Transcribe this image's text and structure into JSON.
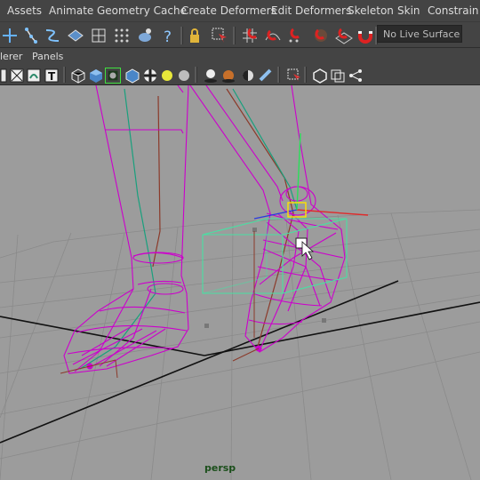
{
  "menubar": {
    "items": [
      "Assets",
      "Animate",
      "Geometry Cache",
      "Create Deformers",
      "Edit Deformers",
      "Skeleton",
      "Skin",
      "Constrain"
    ]
  },
  "shelf": {
    "live_surface": "No Live Surface",
    "icons": [
      "insert-joint-icon",
      "ik-handle-icon",
      "ik-spline-icon",
      "bind-skin-icon",
      "lattice-icon",
      "paint-weights-icon",
      "cluster-icon",
      "help-icon",
      "lock-icon",
      "select-icon",
      "snap-grid-icon",
      "snap-curve-icon",
      "snap-point-icon",
      "snap-view-icon",
      "snap-surface-icon",
      "magnet-icon"
    ]
  },
  "panel_menu": {
    "items": [
      "lerer",
      "Panels"
    ]
  },
  "panel_toolbar": {
    "icons": [
      "wireframe-icon",
      "xray-icon",
      "texture-icon",
      "text-icon",
      "shaded-wire-icon",
      "smooth-shade-icon",
      "isolate-joint-icon",
      "bounding-box-icon",
      "checker-icon",
      "light-icon",
      "default-light-icon",
      "shadow-icon",
      "ambient-occlusion-icon",
      "motion-blur-icon",
      "anti-alias-icon",
      "camera-select-icon",
      "resolution-gate-icon",
      "film-gate-icon",
      "share-icon"
    ]
  },
  "viewport": {
    "camera_label": "persp"
  },
  "colors": {
    "ui_bg": "#444444",
    "viewport_bg": "#9c9c9c",
    "grid": "#8a8a8a",
    "wireframe": "#cc00cc",
    "bone": "#19a07d",
    "locator": "#49e0a3"
  }
}
